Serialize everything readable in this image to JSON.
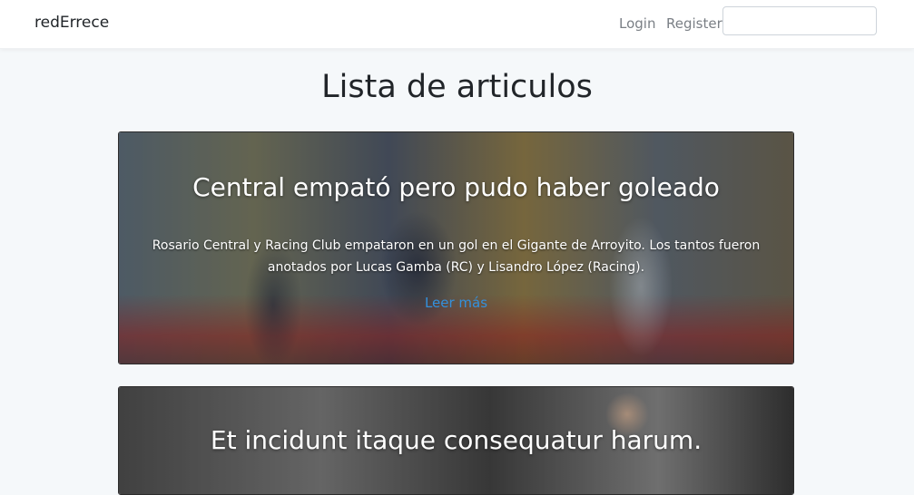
{
  "navbar": {
    "brand": "redErrece",
    "login": "Login",
    "register": "Register",
    "search_value": ""
  },
  "page": {
    "title": "Lista de articulos"
  },
  "articles": [
    {
      "title": "Central empató pero pudo haber goleado",
      "summary": "Rosario Central y Racing Club empataron en un gol en el Gigante de Arroyito. Los tantos fueron anotados por Lucas Gamba (RC) y Lisandro López (Racing).",
      "link": "Leer más"
    },
    {
      "title": "Et incidunt itaque consequatur harum."
    }
  ],
  "colors": {
    "link": "#3490dc",
    "background": "#f5f8fa",
    "navbar": "#ffffff"
  }
}
